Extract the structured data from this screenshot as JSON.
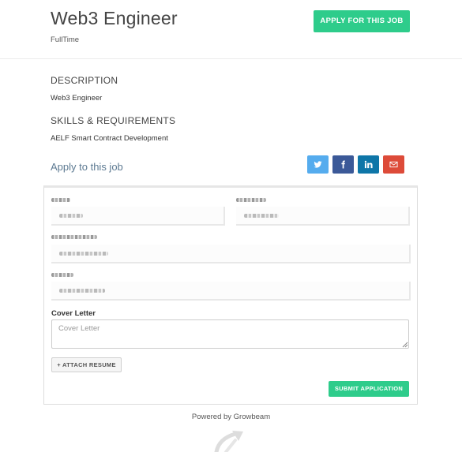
{
  "header": {
    "title": "Web3 Engineer",
    "job_type": "FullTime",
    "apply_button": "APPLY FOR THIS JOB"
  },
  "description": {
    "heading": "DESCRIPTION",
    "text": "Web3 Engineer"
  },
  "skills": {
    "heading": "SKILLS & REQUIREMENTS",
    "text": "AELF Smart Contract Development"
  },
  "apply": {
    "heading": "Apply to this job",
    "share_icons": [
      "twitter-icon",
      "facebook-icon",
      "linkedin-icon",
      "email-icon"
    ],
    "share_colors": [
      "#55acee",
      "#3b5998",
      "#0e76a8",
      "#dd4b39"
    ]
  },
  "form": {
    "cover_letter_label": "Cover Letter",
    "cover_letter_placeholder": "Cover Letter",
    "attach_resume_button": "+ ATTACH RESUME",
    "submit_button": "SUBMIT APPLICATION"
  },
  "footer": {
    "powered_by": "Powered by Growbeam"
  },
  "colors": {
    "accent": "#2ecc8b",
    "apply_heading": "#5d7a92"
  }
}
